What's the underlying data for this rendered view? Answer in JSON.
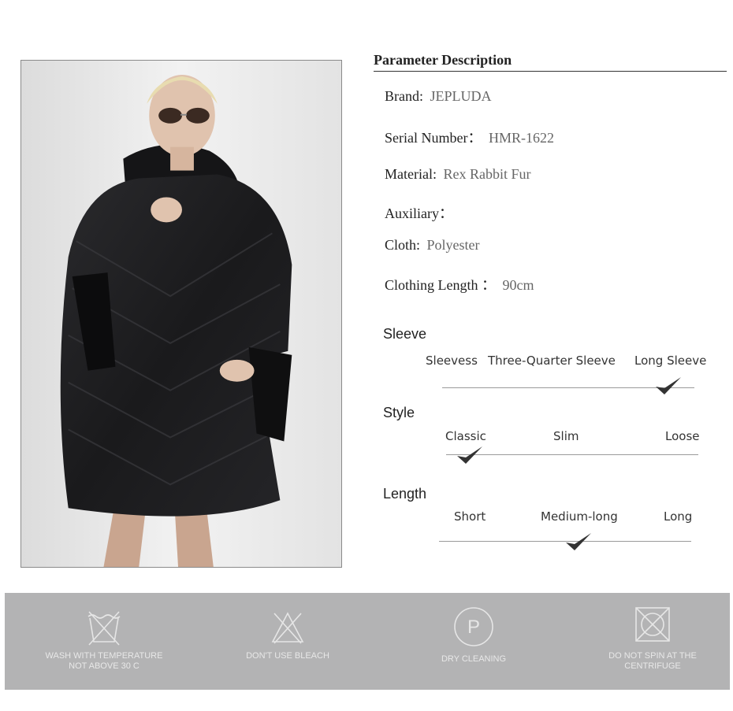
{
  "params": {
    "title": "Parameter Description",
    "rows": [
      {
        "label": "Brand:",
        "value": "JEPLUDA"
      },
      {
        "label": "Serial Number：",
        "value": "HMR-1622"
      },
      {
        "label": "Material:",
        "value": "Rex Rabbit Fur"
      },
      {
        "label": "Auxiliary：",
        "value": ""
      },
      {
        "label": "Cloth:",
        "value": "Polyester"
      },
      {
        "label": "Clothing Length ：",
        "value": "90cm"
      }
    ]
  },
  "attributes": [
    {
      "title": "Sleeve",
      "options": [
        "Sleevess",
        "Three-Quarter Sleeve",
        "Long Sleeve"
      ],
      "selected": "Long Sleeve"
    },
    {
      "title": "Style",
      "options": [
        "Classic",
        "Slim",
        "Loose"
      ],
      "selected": "Classic"
    },
    {
      "title": "Length",
      "options": [
        "Short",
        "Medium-long",
        "Long"
      ],
      "selected": "Medium-long"
    }
  ],
  "care": [
    {
      "icon": "wash-30-icon",
      "label_line1": "WASH WITH TEMPERATURE",
      "label_line2": "NOT ABOVE 30 C"
    },
    {
      "icon": "no-bleach-icon",
      "label_line1": "DON'T USE BLEACH",
      "label_line2": ""
    },
    {
      "icon": "dry-clean-icon",
      "label_line1": "DRY CLEANING",
      "label_line2": "",
      "symbol": "P"
    },
    {
      "icon": "no-tumble-dry-icon",
      "label_line1": "DO NOT SPIN AT THE",
      "label_line2": "CENTRIFUGE"
    }
  ],
  "colors": {
    "care_band": "#b3b3b4",
    "coat": "#1c1c1e",
    "check": "#333333"
  }
}
